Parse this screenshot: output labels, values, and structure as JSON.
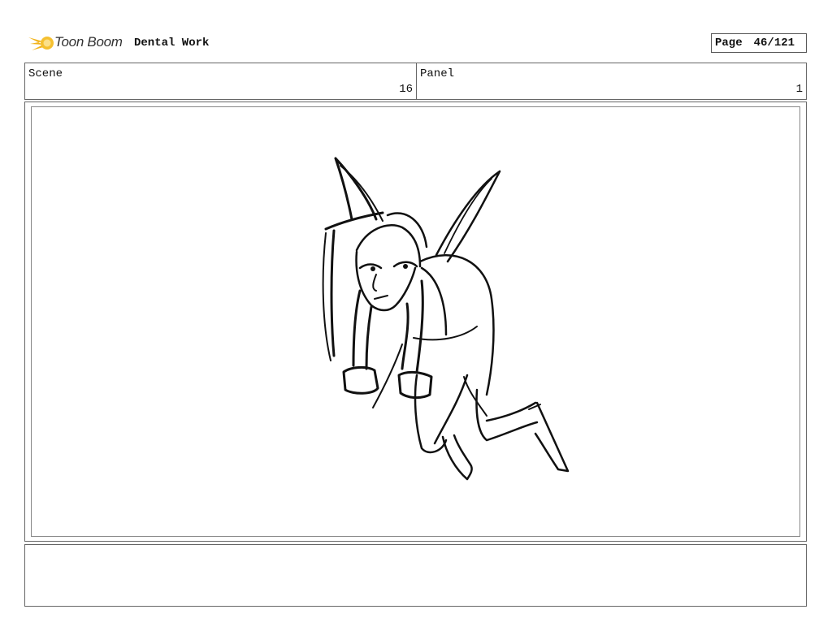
{
  "header": {
    "logo_text": "Toon Boom",
    "project_title": "Dental Work",
    "page_label": "Page",
    "page_number": "46/121"
  },
  "info": {
    "scene_label": "Scene",
    "scene_value": "16",
    "panel_label": "Panel",
    "panel_value": "1"
  },
  "notes": {
    "text": ""
  },
  "colors": {
    "logo_accent": "#f2b31a",
    "border": "#666666",
    "ink": "#111111"
  }
}
